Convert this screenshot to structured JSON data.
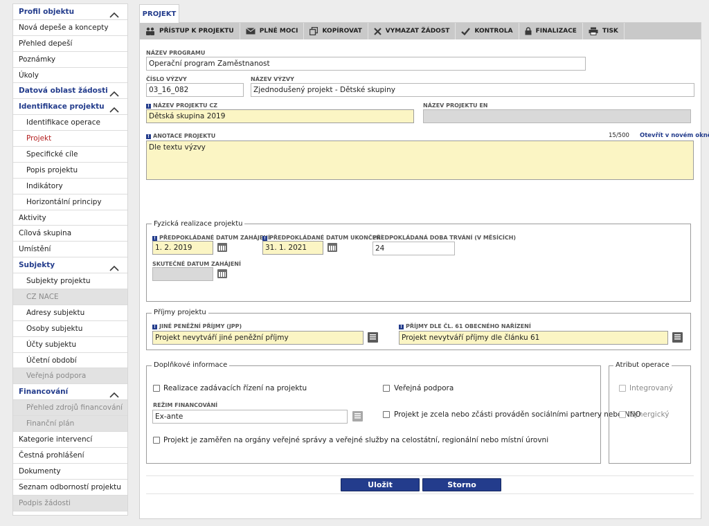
{
  "sidebar": {
    "items": [
      {
        "label": "Profil objektu",
        "type": "header"
      },
      {
        "label": "Nová depeše a koncepty",
        "type": "item"
      },
      {
        "label": "Přehled depeší",
        "type": "item"
      },
      {
        "label": "Poznámky",
        "type": "item"
      },
      {
        "label": "Úkoly",
        "type": "item"
      },
      {
        "label": "Datová oblast žádosti",
        "type": "header"
      },
      {
        "label": "Identifikace projektu",
        "type": "section"
      },
      {
        "label": "Identifikace operace",
        "type": "sub"
      },
      {
        "label": "Projekt",
        "type": "sub-active"
      },
      {
        "label": "Specifické cíle",
        "type": "sub"
      },
      {
        "label": "Popis projektu",
        "type": "sub"
      },
      {
        "label": "Indikátory",
        "type": "sub"
      },
      {
        "label": "Horizontální principy",
        "type": "sub"
      },
      {
        "label": "Aktivity",
        "type": "item"
      },
      {
        "label": "Cílová skupina",
        "type": "item"
      },
      {
        "label": "Umístění",
        "type": "item"
      },
      {
        "label": "Subjekty",
        "type": "section"
      },
      {
        "label": "Subjekty projektu",
        "type": "sub"
      },
      {
        "label": "CZ NACE",
        "type": "sub-disabled"
      },
      {
        "label": "Adresy subjektu",
        "type": "sub"
      },
      {
        "label": "Osoby subjektu",
        "type": "sub"
      },
      {
        "label": "Účty subjektu",
        "type": "sub"
      },
      {
        "label": "Účetní období",
        "type": "sub"
      },
      {
        "label": "Veřejná podpora",
        "type": "sub-disabled"
      },
      {
        "label": "Financování",
        "type": "section"
      },
      {
        "label": "Přehled zdrojů financování",
        "type": "sub-disabled"
      },
      {
        "label": "Finanční plán",
        "type": "sub-disabled"
      },
      {
        "label": "Kategorie intervencí",
        "type": "item"
      },
      {
        "label": "Čestná prohlášení",
        "type": "item"
      },
      {
        "label": "Dokumenty",
        "type": "item"
      },
      {
        "label": "Seznam odborností projektu",
        "type": "item"
      },
      {
        "label": "Podpis žádosti",
        "type": "item-disabled"
      }
    ]
  },
  "tab": {
    "label": "PROJEKT"
  },
  "toolbar": {
    "access": "PŘÍSTUP K PROJEKTU",
    "power": "PLNÉ MOCI",
    "copy": "KOPÍROVAT",
    "delete": "VYMAZAT ŽÁDOST",
    "check": "KONTROLA",
    "finalize": "FINALIZACE",
    "print": "TISK"
  },
  "form": {
    "program_label": "NÁZEV PROGRAMU",
    "program_value": "Operační program Zaměstnanost",
    "call_no_label": "ČÍSLO VÝZVY",
    "call_no_value": "03_16_082",
    "call_name_label": "NÁZEV VÝZVY",
    "call_name_value": "Zjednodušený projekt - Dětské skupiny",
    "project_cz_label": "NÁZEV PROJEKTU CZ",
    "project_cz_value": "Dětská skupina 2019",
    "project_en_label": "NÁZEV PROJEKTU EN",
    "project_en_value": "",
    "annotation_label": "ANOTACE PROJEKTU",
    "annotation_count": "15/500",
    "annotation_open": "Otevřít v novém okně",
    "annotation_value": "Dle textu výzvy"
  },
  "physical": {
    "legend": "Fyzická realizace projektu",
    "start_label": "PŘEDPOKLÁDANÉ DATUM ZAHÁJENÍ",
    "start_value": "1. 2. 2019",
    "end_label": "PŘEDPOKLÁDANÉ DATUM UKONČENÍ",
    "end_value": "31. 1. 2021",
    "duration_label": "PŘEDPOKLÁDANÁ DOBA TRVÁNÍ (V MĚSÍCÍCH)",
    "duration_value": "24",
    "actual_start_label": "SKUTEČNÉ DATUM ZAHÁJENÍ",
    "actual_start_value": ""
  },
  "income": {
    "legend": "Příjmy projektu",
    "jpp_label": "JINÉ PENĚŽNÍ PŘÍJMY (JPP)",
    "jpp_value": "Projekt nevytváří jiné peněžní příjmy",
    "art61_label": "PŘÍJMY DLE ČL. 61 OBECNÉHO NAŘÍZENÍ",
    "art61_value": "Projekt nevytváří příjmy dle článku 61"
  },
  "extra": {
    "legend": "Doplňkové informace",
    "procurement": "Realizace zadávacích řízení na projektu",
    "public_support": "Veřejná podpora",
    "financing_label": "REŽIM FINANCOVÁNÍ",
    "financing_value": "Ex-ante",
    "social_partners": "Projekt je zcela nebo zčásti prováděn sociálními partnery nebo NNO",
    "public_admin": "Projekt je zaměřen na orgány veřejné správy a veřejné služby na celostátní, regionální nebo místní úrovni"
  },
  "attribute": {
    "legend": "Atribut operace",
    "integrated": "Integrovaný",
    "synergic": "Synergický"
  },
  "buttons": {
    "save": "Uložit",
    "cancel": "Storno"
  }
}
